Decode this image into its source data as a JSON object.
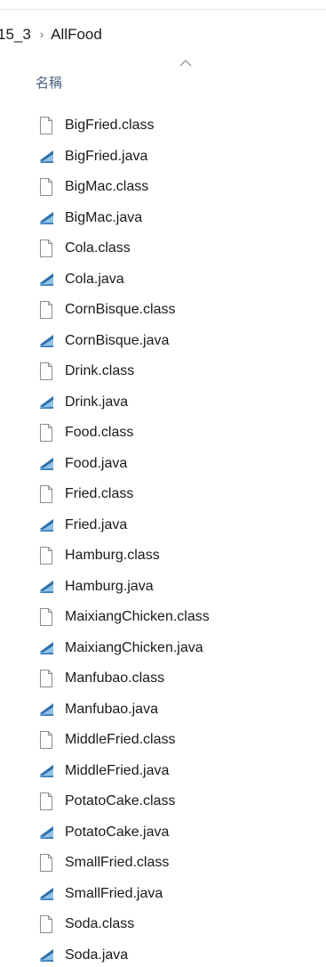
{
  "breadcrumb": {
    "parent_partial": "15_3",
    "separator": "›",
    "current": "AllFood"
  },
  "column_header": {
    "name_label": "名稱",
    "sort_indicator": "chevron-up-icon"
  },
  "icons": {
    "class_file": "blank-document-icon",
    "java_file": "java-source-file-icon",
    "java_icon_colors": [
      "#2f6fa8",
      "#8fc3e8"
    ]
  },
  "files": [
    {
      "name": "BigFried.class",
      "type": "class"
    },
    {
      "name": "BigFried.java",
      "type": "java"
    },
    {
      "name": "BigMac.class",
      "type": "class"
    },
    {
      "name": "BigMac.java",
      "type": "java"
    },
    {
      "name": "Cola.class",
      "type": "class"
    },
    {
      "name": "Cola.java",
      "type": "java"
    },
    {
      "name": "CornBisque.class",
      "type": "class"
    },
    {
      "name": "CornBisque.java",
      "type": "java"
    },
    {
      "name": "Drink.class",
      "type": "class"
    },
    {
      "name": "Drink.java",
      "type": "java"
    },
    {
      "name": "Food.class",
      "type": "class"
    },
    {
      "name": "Food.java",
      "type": "java"
    },
    {
      "name": "Fried.class",
      "type": "class"
    },
    {
      "name": "Fried.java",
      "type": "java"
    },
    {
      "name": "Hamburg.class",
      "type": "class"
    },
    {
      "name": "Hamburg.java",
      "type": "java"
    },
    {
      "name": "MaixiangChicken.class",
      "type": "class"
    },
    {
      "name": "MaixiangChicken.java",
      "type": "java"
    },
    {
      "name": "Manfubao.class",
      "type": "class"
    },
    {
      "name": "Manfubao.java",
      "type": "java"
    },
    {
      "name": "MiddleFried.class",
      "type": "class"
    },
    {
      "name": "MiddleFried.java",
      "type": "java"
    },
    {
      "name": "PotatoCake.class",
      "type": "class"
    },
    {
      "name": "PotatoCake.java",
      "type": "java"
    },
    {
      "name": "SmallFried.class",
      "type": "class"
    },
    {
      "name": "SmallFried.java",
      "type": "java"
    },
    {
      "name": "Soda.class",
      "type": "class"
    },
    {
      "name": "Soda.java",
      "type": "java"
    }
  ]
}
